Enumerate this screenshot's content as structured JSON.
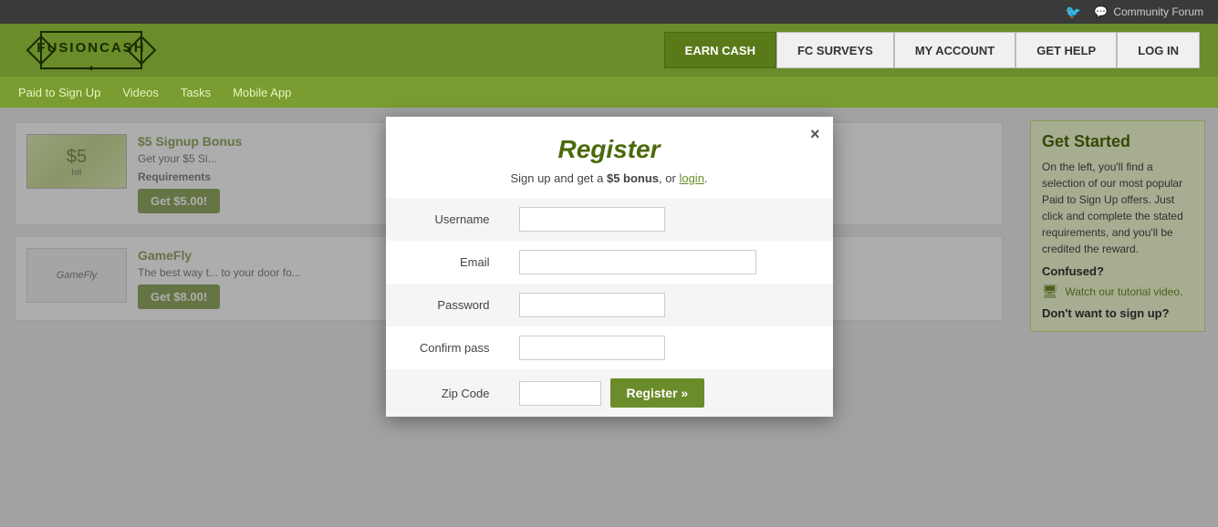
{
  "topbar": {
    "twitter_icon": "🐦",
    "forum_icon": "💬",
    "community_forum_label": "Community Forum",
    "community_forum_url": "#"
  },
  "header": {
    "logo_text": "FUSIONCASH",
    "nav": {
      "tabs": [
        {
          "id": "earn-cash",
          "label": "EARN CASH",
          "active": true
        },
        {
          "id": "fc-surveys",
          "label": "FC SURVEYS",
          "active": false
        },
        {
          "id": "my-account",
          "label": "MY ACCOUNT",
          "active": false
        },
        {
          "id": "get-help",
          "label": "GET HELP",
          "active": false
        },
        {
          "id": "log-in",
          "label": "LOG IN",
          "active": false
        }
      ]
    },
    "subnav": [
      {
        "id": "paid-to-signup",
        "label": "Paid to Sign Up"
      },
      {
        "id": "videos",
        "label": "Videos"
      },
      {
        "id": "tasks",
        "label": "Tasks"
      },
      {
        "id": "mobile-apps",
        "label": "Mobile App"
      }
    ]
  },
  "offers": [
    {
      "id": "signup-bonus",
      "image_text": "$5",
      "title": "$5 Signup Bonus",
      "desc": "Get your $5 Si...",
      "req_label": "Requirements",
      "btn_label": "Get $5.00!"
    },
    {
      "id": "gamefly",
      "image_text": "GameFly",
      "title": "GameFly",
      "desc": "The best way t... to your door fo...",
      "btn_label": "Get $8.00!"
    }
  ],
  "sidebar": {
    "get_started_title": "Get Started",
    "get_started_text": "On the left, you'll find a selection of our most popular Paid to Sign Up offers. Just click and complete the stated requirements, and you'll be credited the reward.",
    "confused_label": "Confused?",
    "tutorial_link": "Watch our tutorial video.",
    "dont_sign_up": "Don't want to sign up?"
  },
  "modal": {
    "close_label": "×",
    "title": "Register",
    "subtitle_text": "Sign up and get a ",
    "bonus_text": "$5 bonus",
    "subtitle_mid": ", or ",
    "login_link": "login",
    "subtitle_end": ".",
    "fields": [
      {
        "id": "username",
        "label": "Username",
        "placeholder": ""
      },
      {
        "id": "email",
        "label": "Email",
        "placeholder": ""
      },
      {
        "id": "password",
        "label": "Password",
        "placeholder": ""
      },
      {
        "id": "confirm-pass",
        "label": "Confirm pass",
        "placeholder": ""
      },
      {
        "id": "zip-code",
        "label": "Zip Code",
        "placeholder": ""
      }
    ],
    "register_btn_label": "Register »"
  }
}
